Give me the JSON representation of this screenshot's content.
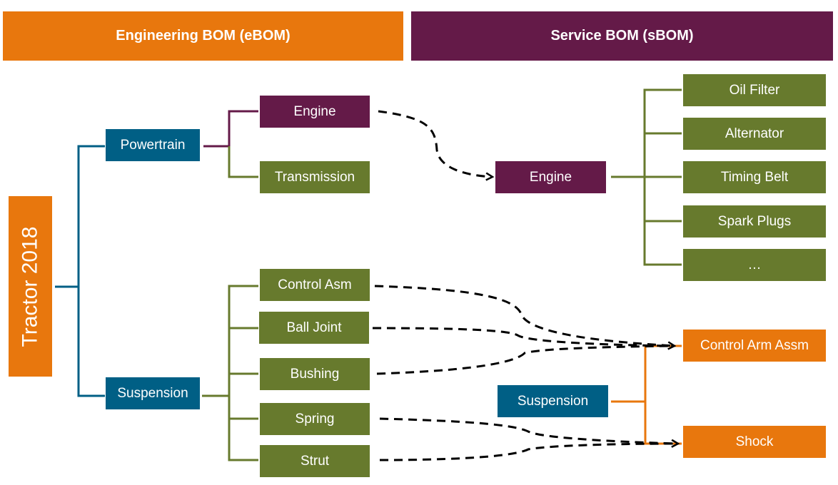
{
  "colors": {
    "orange": "#E8770D",
    "purple": "#641A48",
    "blue": "#005F85",
    "green": "#677A2D",
    "dash": "#000000"
  },
  "headers": {
    "ebom": "Engineering BOM (eBOM)",
    "sbom": "Service BOM (sBOM)"
  },
  "ebom": {
    "root": "Tractor 2018",
    "powertrain": {
      "label": "Powertrain",
      "children": [
        "Engine",
        "Transmission"
      ]
    },
    "suspension": {
      "label": "Suspension",
      "children": [
        "Control Asm",
        "Ball Joint",
        "Bushing",
        "Spring",
        "Strut"
      ]
    }
  },
  "sbom": {
    "engine": {
      "label": "Engine",
      "children": [
        "Oil Filter",
        "Alternator",
        "Timing Belt",
        "Spark Plugs",
        "…"
      ]
    },
    "suspension": {
      "label": "Suspension",
      "children": [
        "Control Arm Assm",
        "Shock"
      ]
    }
  },
  "mappings": [
    {
      "from": "eBOM Engine",
      "to": "sBOM Engine"
    },
    {
      "from": "Control Asm",
      "to": "Control Arm Assm"
    },
    {
      "from": "Ball Joint",
      "to": "Control Arm Assm"
    },
    {
      "from": "Bushing",
      "to": "Control Arm Assm"
    },
    {
      "from": "Spring",
      "to": "Shock"
    },
    {
      "from": "Strut",
      "to": "Shock"
    }
  ]
}
